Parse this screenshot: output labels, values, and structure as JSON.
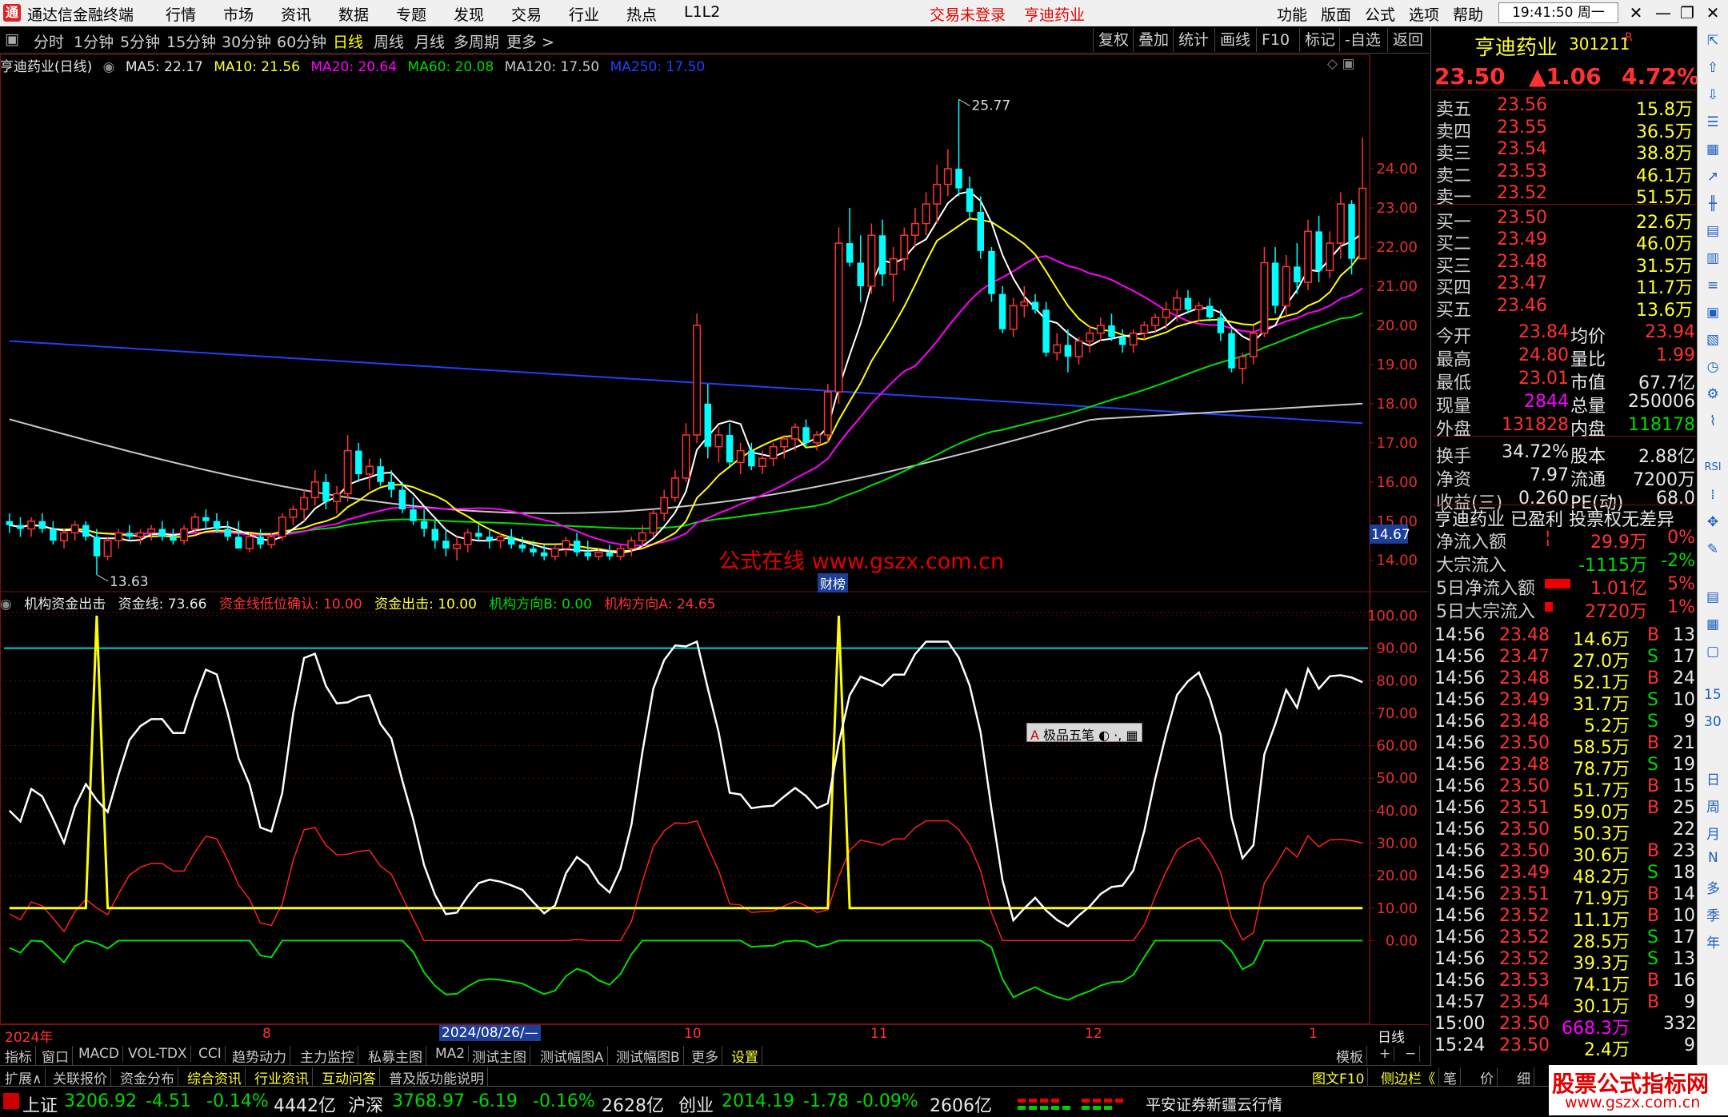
{
  "menu": {
    "app_title": "通达信金融终端",
    "items": [
      "行情",
      "市场",
      "资讯",
      "数据",
      "专题",
      "发现",
      "交易",
      "行业",
      "热点",
      "L1L2"
    ],
    "trade_status": "交易未登录",
    "stock_name": "亨迪药业",
    "right_items": [
      "功能",
      "版面",
      "公式",
      "选项",
      "帮助"
    ],
    "clock": "19:41:50 周一"
  },
  "period_tabs": [
    "分时",
    "1分钟",
    "5分钟",
    "15分钟",
    "30分钟",
    "60分钟",
    "日线",
    "周线",
    "月线",
    "多周期",
    "更多 >"
  ],
  "selected_period": "日线",
  "tools": [
    "复权",
    "叠加",
    "统计",
    "画线",
    "F10",
    "标记",
    "-自选",
    "返回"
  ],
  "main_chart": {
    "title": "亨迪药业(日线)",
    "ma": [
      {
        "label": "MA5: 22.17",
        "color": "#ffffff"
      },
      {
        "label": "MA10: 21.56",
        "color": "#ffff00"
      },
      {
        "label": "MA20: 20.64",
        "color": "#ff00ff"
      },
      {
        "label": "MA60: 20.08",
        "color": "#00e000"
      },
      {
        "label": "MA120: 17.50",
        "color": "#c8c8c8"
      },
      {
        "label": "MA250: 17.50",
        "color": "#2040ff"
      }
    ],
    "high_label": "25.77",
    "low_label": "13.63",
    "price_ticks": [
      "24.00",
      "23.00",
      "22.00",
      "21.00",
      "20.00",
      "19.00",
      "18.00",
      "17.00",
      "16.00",
      "15.00",
      "14.00"
    ],
    "current_price_tag": "14.67",
    "watermark": "公式在线  www.gszx.com.cn",
    "caiwu_tag": "财榜"
  },
  "indicator": {
    "title": "机构资金出击",
    "values": [
      {
        "label": "资金线: 73.66",
        "color": "#ffffff"
      },
      {
        "label": "资金线低位确认: 10.00",
        "color": "#ff3232"
      },
      {
        "label": "资金出击: 10.00",
        "color": "#ffff00"
      },
      {
        "label": "机构方向B: 0.00",
        "color": "#00e000"
      },
      {
        "label": "机构方向A: 24.65",
        "color": "#ff3232"
      }
    ],
    "ticks": [
      "100.00",
      "90.00",
      "80.00",
      "70.00",
      "60.00",
      "50.00",
      "40.00",
      "30.00",
      "20.00",
      "10.00",
      "0.00"
    ],
    "toolbar_label": "极品五笔"
  },
  "chart_data": {
    "type": "candlestick",
    "candles_ohlc": [
      [
        15.0,
        15.2,
        14.7,
        14.9
      ],
      [
        14.9,
        15.1,
        14.6,
        14.8
      ],
      [
        14.8,
        15.1,
        14.6,
        15.0
      ],
      [
        15.0,
        15.2,
        14.7,
        14.8
      ],
      [
        14.8,
        15.0,
        14.4,
        14.5
      ],
      [
        14.5,
        14.8,
        14.3,
        14.7
      ],
      [
        14.7,
        15.0,
        14.5,
        14.9
      ],
      [
        14.9,
        15.0,
        14.5,
        14.6
      ],
      [
        14.6,
        14.8,
        13.63,
        14.1
      ],
      [
        14.1,
        14.6,
        14.0,
        14.5
      ],
      [
        14.5,
        14.8,
        14.3,
        14.7
      ],
      [
        14.7,
        14.9,
        14.5,
        14.6
      ],
      [
        14.6,
        14.8,
        14.4,
        14.7
      ],
      [
        14.7,
        14.9,
        14.5,
        14.8
      ],
      [
        14.8,
        15.0,
        14.5,
        14.6
      ],
      [
        14.6,
        14.8,
        14.4,
        14.5
      ],
      [
        14.5,
        14.9,
        14.4,
        14.8
      ],
      [
        14.8,
        15.2,
        14.7,
        15.1
      ],
      [
        15.1,
        15.3,
        14.8,
        15.0
      ],
      [
        15.0,
        15.2,
        14.7,
        14.8
      ],
      [
        14.8,
        15.0,
        14.5,
        14.6
      ],
      [
        14.6,
        15.0,
        14.4,
        14.3
      ],
      [
        14.3,
        14.7,
        14.2,
        14.6
      ],
      [
        14.6,
        14.8,
        14.3,
        14.4
      ],
      [
        14.4,
        14.7,
        14.3,
        14.6
      ],
      [
        14.6,
        15.2,
        14.5,
        15.1
      ],
      [
        15.1,
        15.4,
        14.9,
        15.3
      ],
      [
        15.3,
        15.8,
        15.0,
        15.6
      ],
      [
        15.6,
        16.3,
        15.4,
        16.0
      ],
      [
        16.0,
        16.2,
        15.3,
        15.5
      ],
      [
        15.5,
        15.9,
        15.2,
        15.7
      ],
      [
        15.7,
        17.2,
        15.5,
        16.8
      ],
      [
        16.8,
        17.0,
        16.0,
        16.2
      ],
      [
        16.2,
        16.6,
        15.8,
        16.4
      ],
      [
        16.4,
        16.6,
        15.9,
        16.0
      ],
      [
        16.0,
        16.3,
        15.6,
        15.8
      ],
      [
        15.8,
        16.0,
        15.2,
        15.3
      ],
      [
        15.3,
        15.6,
        14.9,
        15.0
      ],
      [
        15.0,
        15.3,
        14.6,
        14.8
      ],
      [
        14.8,
        15.0,
        14.3,
        14.5
      ],
      [
        14.5,
        14.8,
        14.1,
        14.3
      ],
      [
        14.3,
        14.6,
        14.0,
        14.4
      ],
      [
        14.4,
        14.8,
        14.2,
        14.7
      ],
      [
        14.7,
        14.9,
        14.5,
        14.6
      ],
      [
        14.6,
        14.8,
        14.3,
        14.5
      ],
      [
        14.5,
        14.7,
        14.3,
        14.6
      ],
      [
        14.6,
        14.8,
        14.3,
        14.4
      ],
      [
        14.4,
        14.6,
        14.2,
        14.3
      ],
      [
        14.3,
        14.5,
        14.1,
        14.2
      ],
      [
        14.2,
        14.4,
        14.0,
        14.1
      ],
      [
        14.1,
        14.4,
        14.0,
        14.3
      ],
      [
        14.3,
        14.6,
        14.1,
        14.5
      ],
      [
        14.5,
        14.7,
        14.1,
        14.2
      ],
      [
        14.2,
        14.5,
        14.0,
        14.1
      ],
      [
        14.1,
        14.3,
        14.0,
        14.2
      ],
      [
        14.2,
        14.4,
        14.0,
        14.1
      ],
      [
        14.1,
        14.4,
        14.0,
        14.3
      ],
      [
        14.3,
        14.6,
        14.1,
        14.5
      ],
      [
        14.5,
        14.9,
        14.3,
        14.7
      ],
      [
        14.7,
        15.3,
        14.6,
        15.2
      ],
      [
        15.2,
        15.8,
        15.0,
        15.6
      ],
      [
        15.6,
        16.3,
        15.5,
        16.1
      ],
      [
        16.1,
        17.5,
        16.0,
        17.2
      ],
      [
        17.2,
        20.3,
        17.0,
        20.0
      ],
      [
        18.0,
        18.5,
        16.6,
        16.9
      ],
      [
        16.9,
        17.4,
        16.5,
        17.2
      ],
      [
        17.2,
        17.5,
        16.4,
        16.5
      ],
      [
        16.5,
        17.0,
        16.2,
        16.8
      ],
      [
        16.8,
        17.0,
        16.3,
        16.4
      ],
      [
        16.4,
        16.8,
        16.2,
        16.6
      ],
      [
        16.6,
        17.0,
        16.4,
        16.9
      ],
      [
        16.9,
        17.2,
        16.6,
        17.1
      ],
      [
        17.1,
        17.5,
        16.8,
        17.4
      ],
      [
        17.4,
        17.6,
        16.9,
        17.0
      ],
      [
        17.0,
        17.3,
        16.8,
        17.2
      ],
      [
        17.2,
        18.5,
        17.0,
        18.3
      ],
      [
        18.3,
        22.5,
        18.0,
        22.1
      ],
      [
        22.1,
        23.0,
        21.5,
        21.6
      ],
      [
        21.6,
        22.3,
        20.6,
        21.0
      ],
      [
        21.0,
        22.6,
        20.8,
        22.3
      ],
      [
        22.3,
        22.7,
        21.0,
        21.3
      ],
      [
        21.3,
        22.0,
        20.6,
        21.7
      ],
      [
        21.7,
        22.5,
        21.4,
        22.3
      ],
      [
        22.3,
        23.0,
        22.0,
        22.6
      ],
      [
        22.6,
        23.4,
        22.3,
        23.1
      ],
      [
        23.1,
        24.1,
        22.6,
        23.6
      ],
      [
        23.6,
        24.5,
        23.3,
        24.0
      ],
      [
        24.0,
        25.77,
        23.3,
        23.5
      ],
      [
        23.5,
        23.8,
        22.7,
        22.9
      ],
      [
        22.9,
        23.3,
        21.7,
        21.9
      ],
      [
        21.9,
        22.0,
        20.6,
        20.8
      ],
      [
        20.8,
        21.0,
        19.8,
        19.9
      ],
      [
        19.9,
        20.7,
        19.7,
        20.5
      ],
      [
        20.5,
        21.0,
        20.2,
        20.6
      ],
      [
        20.6,
        20.8,
        20.3,
        20.4
      ],
      [
        20.4,
        20.6,
        19.2,
        19.3
      ],
      [
        19.3,
        19.8,
        19.1,
        19.5
      ],
      [
        19.5,
        19.9,
        18.8,
        19.2
      ],
      [
        19.2,
        19.7,
        19.0,
        19.6
      ],
      [
        19.6,
        20.0,
        19.3,
        19.8
      ],
      [
        19.8,
        20.2,
        19.6,
        20.0
      ],
      [
        20.0,
        20.3,
        19.6,
        19.7
      ],
      [
        19.7,
        19.9,
        19.3,
        19.5
      ],
      [
        19.5,
        19.9,
        19.3,
        19.8
      ],
      [
        19.8,
        20.1,
        19.6,
        20.0
      ],
      [
        20.0,
        20.3,
        19.8,
        20.2
      ],
      [
        20.2,
        20.6,
        19.9,
        20.4
      ],
      [
        20.4,
        20.9,
        20.1,
        20.7
      ],
      [
        20.7,
        20.9,
        20.3,
        20.4
      ],
      [
        20.4,
        20.6,
        20.1,
        20.5
      ],
      [
        20.5,
        20.7,
        20.1,
        20.2
      ],
      [
        20.2,
        20.4,
        19.6,
        19.8
      ],
      [
        19.8,
        19.9,
        18.8,
        18.9
      ],
      [
        18.9,
        19.3,
        18.5,
        19.2
      ],
      [
        19.2,
        20.0,
        19.0,
        19.8
      ],
      [
        19.8,
        22.0,
        19.7,
        21.6
      ],
      [
        21.6,
        22.0,
        20.3,
        20.5
      ],
      [
        20.5,
        21.8,
        20.2,
        21.5
      ],
      [
        21.5,
        22.1,
        20.8,
        21.1
      ],
      [
        21.1,
        22.7,
        20.9,
        22.4
      ],
      [
        22.4,
        22.8,
        21.1,
        21.4
      ],
      [
        21.4,
        22.4,
        21.2,
        22.1
      ],
      [
        22.1,
        23.4,
        21.7,
        23.1
      ],
      [
        23.1,
        23.2,
        21.3,
        21.7
      ],
      [
        21.7,
        24.8,
        21.7,
        23.5
      ]
    ],
    "price_range": [
      13.3,
      25.9
    ],
    "indicator_range": [
      -25,
      100
    ]
  },
  "date_axis": [
    "2024年",
    "8",
    "2024/08/26/—",
    "10",
    "11",
    "12",
    "1",
    "日线"
  ],
  "bottom_tabs": [
    "指标",
    "窗口",
    "MACD",
    "VOL-TDX",
    "CCI",
    "趋势动力",
    "主力监控",
    "私募主图",
    "MA2",
    "测试主图",
    "测试幅图A",
    "测试幅图B",
    "更多",
    "设置"
  ],
  "bottom_right": [
    "模板",
    "+",
    "−"
  ],
  "bottom_row2": [
    "扩展∧",
    "关联报价",
    "资金分布",
    "综合资讯",
    "行业资讯",
    "互动问答",
    "普及版功能说明"
  ],
  "bottom_row2_right": [
    "图文F10",
    "侧边栏《",
    "笔",
    "价",
    "细"
  ],
  "status_bar": {
    "sh": {
      "name": "上证",
      "value": "3206.92",
      "change": "-4.51",
      "pct": "-0.14%",
      "amount": "4442亿"
    },
    "hs": {
      "name": "沪深",
      "value": "3768.97",
      "change": "-6.19",
      "pct": "-0.16%",
      "amount": "2628亿"
    },
    "cy": {
      "name": "创业",
      "value": "2014.19",
      "change": "-1.78",
      "pct": "-0.09%",
      "amount": "2606亿"
    },
    "broker": "平安证券新疆云行情"
  },
  "quote": {
    "name": "亨迪药业",
    "code": "301211",
    "flag": "R",
    "price": "23.50",
    "change": "▲1.06",
    "pct": "4.72%",
    "sell": [
      {
        "label": "卖五",
        "price": "23.56",
        "vol": "15.8万"
      },
      {
        "label": "卖四",
        "price": "23.55",
        "vol": "36.5万"
      },
      {
        "label": "卖三",
        "price": "23.54",
        "vol": "38.8万"
      },
      {
        "label": "卖二",
        "price": "23.53",
        "vol": "46.1万"
      },
      {
        "label": "卖一",
        "price": "23.52",
        "vol": "51.5万"
      }
    ],
    "buy": [
      {
        "label": "买一",
        "price": "23.50",
        "vol": "22.6万"
      },
      {
        "label": "买二",
        "price": "23.49",
        "vol": "46.0万"
      },
      {
        "label": "买三",
        "price": "23.48",
        "vol": "31.5万"
      },
      {
        "label": "买四",
        "price": "23.47",
        "vol": "11.7万"
      },
      {
        "label": "买五",
        "price": "23.46",
        "vol": "13.6万"
      }
    ],
    "stats": [
      [
        "今开",
        "23.84",
        "均价",
        "23.94"
      ],
      [
        "最高",
        "24.80",
        "量比",
        "1.99"
      ],
      [
        "最低",
        "23.01",
        "市值",
        "67.7亿"
      ],
      [
        "现量",
        "2844",
        "总量",
        "250006"
      ],
      [
        "外盘",
        "131828",
        "内盘",
        "118178"
      ],
      [
        "换手",
        "34.72%",
        "股本",
        "2.88亿"
      ],
      [
        "净资",
        "7.97",
        "流通",
        "7200万"
      ],
      [
        "收益(三)",
        "0.260",
        "PE(动)",
        "68.0"
      ]
    ],
    "info_line": "亨迪药业 已盈利 投票权无差异",
    "flows": [
      {
        "label": "净流入额",
        "value": "29.9万",
        "pct": "0%"
      },
      {
        "label": "大宗流入",
        "value": "-1115万",
        "pct": "-2%"
      },
      {
        "label": "5日净流入额",
        "value": "1.01亿",
        "pct": "5%"
      },
      {
        "label": "5日大宗流入",
        "value": "2720万",
        "pct": "1%"
      }
    ],
    "ticks": [
      [
        "14:56",
        "23.48",
        "14.6万",
        "B",
        "13"
      ],
      [
        "14:56",
        "23.47",
        "27.0万",
        "S",
        "17"
      ],
      [
        "14:56",
        "23.48",
        "52.1万",
        "B",
        "24"
      ],
      [
        "14:56",
        "23.49",
        "31.7万",
        "S",
        "10"
      ],
      [
        "14:56",
        "23.48",
        "5.2万",
        "S",
        "9"
      ],
      [
        "14:56",
        "23.50",
        "58.5万",
        "B",
        "21"
      ],
      [
        "14:56",
        "23.48",
        "78.7万",
        "S",
        "19"
      ],
      [
        "14:56",
        "23.50",
        "51.7万",
        "B",
        "15"
      ],
      [
        "14:56",
        "23.51",
        "59.0万",
        "B",
        "25"
      ],
      [
        "14:56",
        "23.50",
        "50.3万",
        "",
        "22"
      ],
      [
        "14:56",
        "23.50",
        "30.6万",
        "B",
        "23"
      ],
      [
        "14:56",
        "23.49",
        "48.2万",
        "S",
        "18"
      ],
      [
        "14:56",
        "23.51",
        "71.9万",
        "B",
        "14"
      ],
      [
        "14:56",
        "23.52",
        "11.1万",
        "B",
        "10"
      ],
      [
        "14:56",
        "23.52",
        "28.5万",
        "S",
        "17"
      ],
      [
        "14:56",
        "23.52",
        "39.3万",
        "S",
        "13"
      ],
      [
        "14:56",
        "23.53",
        "74.1万",
        "B",
        "16"
      ],
      [
        "14:57",
        "23.54",
        "30.1万",
        "B",
        "9"
      ],
      [
        "15:00",
        "23.50",
        "668.3万",
        "",
        "332"
      ],
      [
        "15:24",
        "23.50",
        "2.4万",
        "",
        "9"
      ]
    ]
  },
  "side_icons": [
    "15",
    "30",
    "日",
    "周",
    "月",
    "N",
    "多",
    "季",
    "年"
  ],
  "corner_watermark": {
    "title": "股票公式指标网",
    "url": "www.gszx.com.cn"
  }
}
